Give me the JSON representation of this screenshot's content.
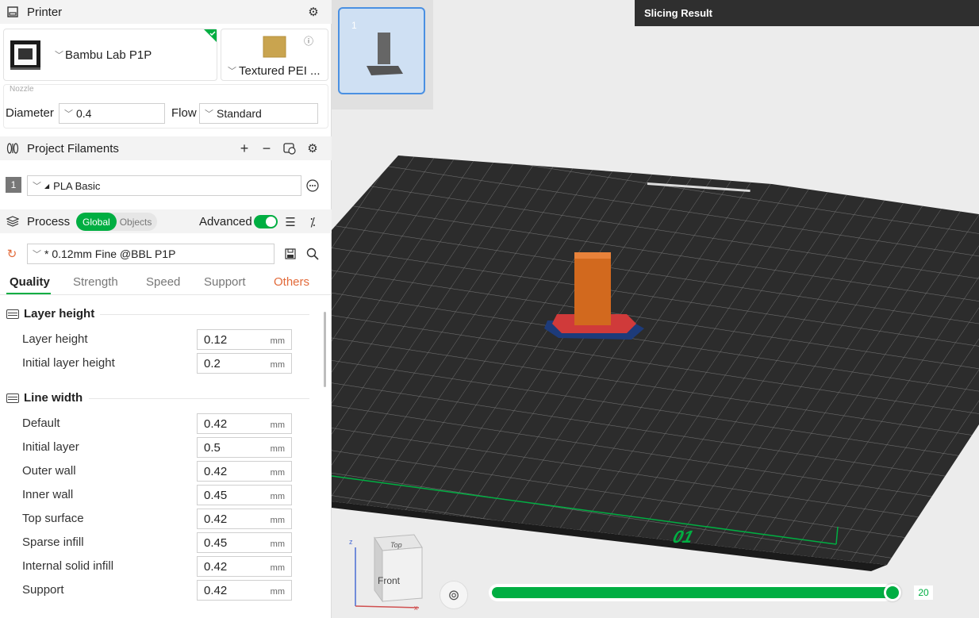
{
  "printer": {
    "header": "Printer",
    "name": "Bambu Lab P1P",
    "plate": "Textured PEI ...",
    "nozzle_label": "Nozzle",
    "diameter_label": "Diameter",
    "diameter_value": "0.4",
    "flow_label": "Flow",
    "flow_value": "Standard"
  },
  "filaments": {
    "header": "Project Filaments",
    "items": [
      {
        "index": "1",
        "name": "PLA Basic"
      }
    ]
  },
  "process": {
    "header": "Process",
    "scope_global": "Global",
    "scope_objects": "Objects",
    "advanced_label": "Advanced",
    "preset": "* 0.12mm Fine @BBL P1P",
    "tabs": [
      "Quality",
      "Strength",
      "Speed",
      "Support",
      "Others"
    ],
    "groups": [
      {
        "title": "Layer height",
        "rows": [
          {
            "label": "Layer height",
            "value": "0.12",
            "unit": "mm"
          },
          {
            "label": "Initial layer height",
            "value": "0.2",
            "unit": "mm"
          }
        ]
      },
      {
        "title": "Line width",
        "rows": [
          {
            "label": "Default",
            "value": "0.42",
            "unit": "mm"
          },
          {
            "label": "Initial layer",
            "value": "0.5",
            "unit": "mm"
          },
          {
            "label": "Outer wall",
            "value": "0.42",
            "unit": "mm"
          },
          {
            "label": "Inner wall",
            "value": "0.45",
            "unit": "mm"
          },
          {
            "label": "Top surface",
            "value": "0.42",
            "unit": "mm"
          },
          {
            "label": "Sparse infill",
            "value": "0.45",
            "unit": "mm"
          },
          {
            "label": "Internal solid infill",
            "value": "0.42",
            "unit": "mm"
          },
          {
            "label": "Support",
            "value": "0.42",
            "unit": "mm"
          }
        ]
      }
    ]
  },
  "view": {
    "slicing_result": "Slicing Result",
    "plate_thumb_index": "1",
    "plate_number": "01",
    "layer_value": "20",
    "layer_slider_fraction": 1.0,
    "cube_top": "Top",
    "cube_front": "Front",
    "axis_x": "x",
    "axis_z": "z"
  }
}
